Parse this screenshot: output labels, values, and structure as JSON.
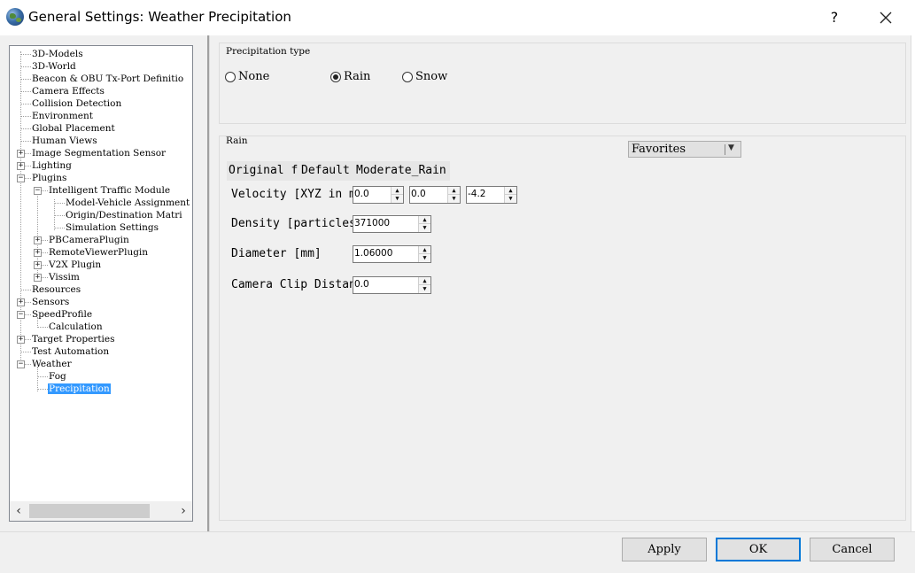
{
  "window": {
    "title": "General Settings: Weather Precipitation",
    "help": "?"
  },
  "tree": {
    "items": [
      {
        "label": "3D-Models"
      },
      {
        "label": "3D-World"
      },
      {
        "label": "Beacon & OBU Tx-Port Definitio"
      },
      {
        "label": "Camera Effects"
      },
      {
        "label": "Collision Detection"
      },
      {
        "label": "Environment"
      },
      {
        "label": "Global Placement"
      },
      {
        "label": "Human Views"
      },
      {
        "label": "Image Segmentation Sensor"
      },
      {
        "label": "Lighting"
      },
      {
        "label": "Plugins"
      },
      {
        "label": "Intelligent Traffic Module"
      },
      {
        "label": "Model-Vehicle Assignment"
      },
      {
        "label": "Origin/Destination Matri"
      },
      {
        "label": "Simulation Settings"
      },
      {
        "label": "PBCameraPlugin"
      },
      {
        "label": "RemoteViewerPlugin"
      },
      {
        "label": "V2X Plugin"
      },
      {
        "label": "Vissim"
      },
      {
        "label": "Resources"
      },
      {
        "label": "Sensors"
      },
      {
        "label": "SpeedProfile"
      },
      {
        "label": "Calculation"
      },
      {
        "label": "Target Properties"
      },
      {
        "label": "Test Automation"
      },
      {
        "label": "Weather"
      },
      {
        "label": "Fog"
      },
      {
        "label": "Precipitation"
      }
    ],
    "selected": "Precipitation"
  },
  "precipitation_type": {
    "title": "Precipitation type",
    "options": [
      "None",
      "Rain",
      "Snow"
    ],
    "selected": "Rain"
  },
  "rain": {
    "title": "Rain",
    "favorites_label": "Favorites",
    "preset_header": {
      "col1": "Original f",
      "col2": "Default",
      "col3": "Moderate_Rain"
    },
    "fields": {
      "velocity_label": "Velocity [XYZ in m/s]",
      "velocity_x": "0.0",
      "velocity_y": "0.0",
      "velocity_z": "-4.2",
      "density_label": "Density [particles]",
      "density_value": "371000",
      "diameter_label": "Diameter [mm]",
      "diameter_value": "1.06000",
      "clip_label": "Camera Clip Distance",
      "clip_value": "0.0"
    }
  },
  "buttons": {
    "apply": "Apply",
    "ok": "OK",
    "cancel": "Cancel"
  }
}
